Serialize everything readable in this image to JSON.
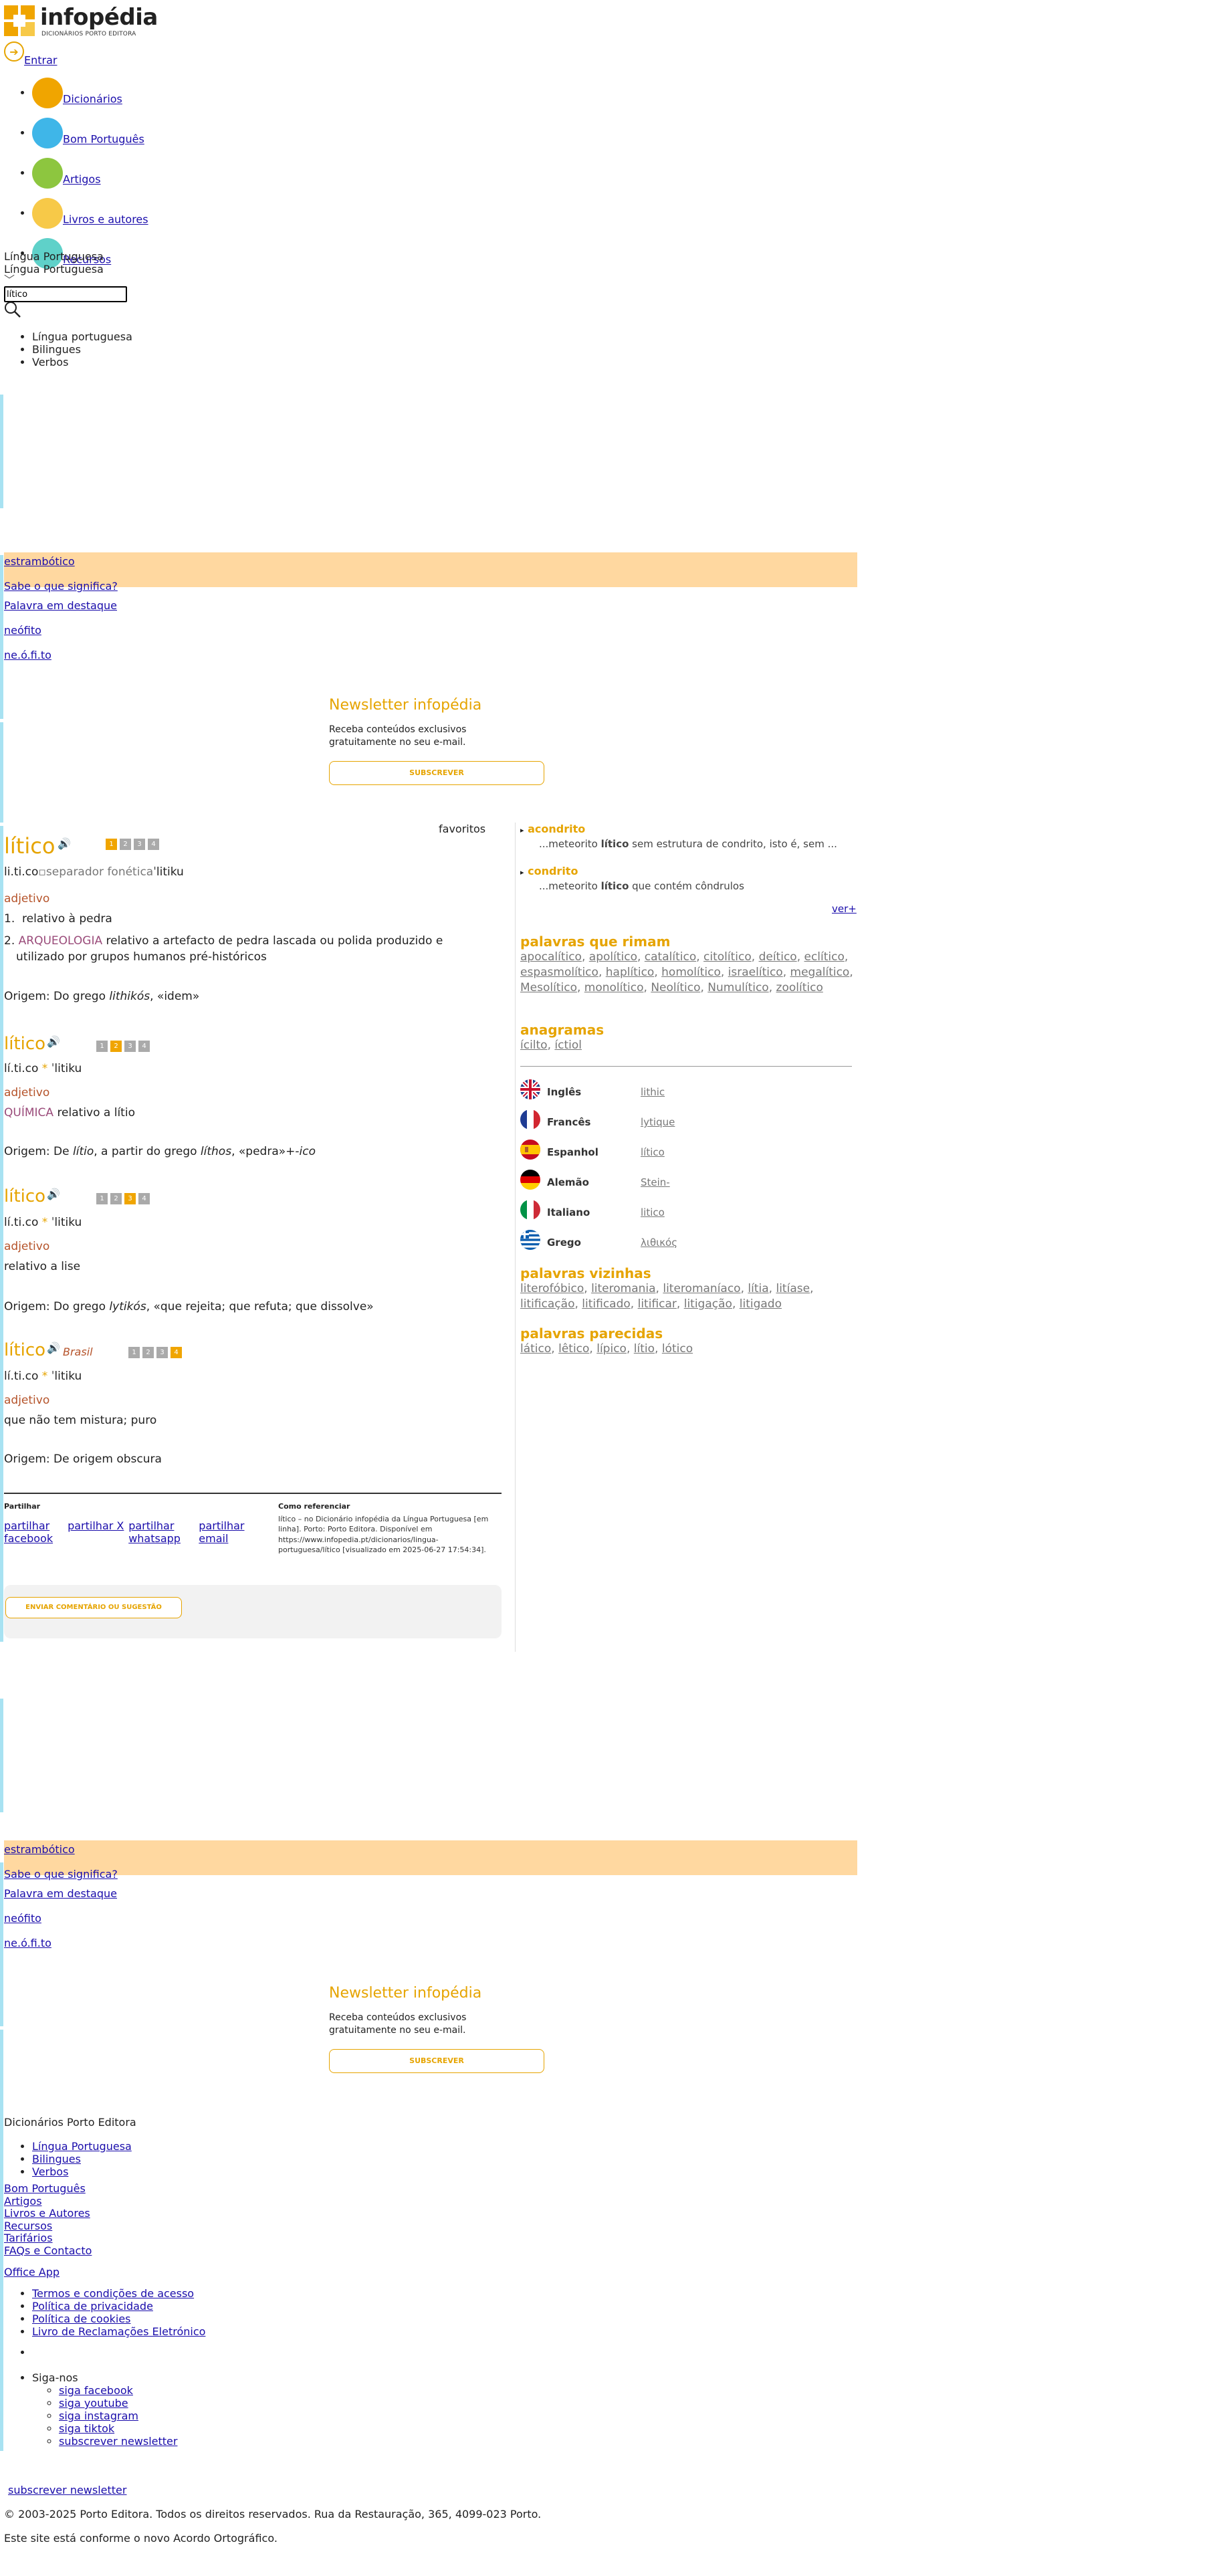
{
  "header": {
    "logo_name": "infopédia",
    "logo_sub": "DICIONÁRIOS PORTO EDITORA",
    "enter_label": "Entrar",
    "nav": [
      {
        "label": "Dicionários",
        "icon": "books-icon",
        "color": "#f0a500"
      },
      {
        "label": "Bom Português",
        "icon": "pen-icon",
        "color": "#3fb6e8"
      },
      {
        "label": "Artigos",
        "icon": "article-icon",
        "color": "#8dc63f"
      },
      {
        "label": "Livros e autores",
        "icon": "author-icon",
        "color": "#f7c948"
      },
      {
        "label": "Recursos",
        "icon": "resources-icon",
        "color": "#5fd1c9"
      }
    ],
    "lang_selected": "Língua Portuguesa",
    "lang_selected_2": "Língua Portuguesa",
    "search_value": "lítico",
    "search_options": [
      "Língua portuguesa",
      "Bilingues",
      "Verbos"
    ]
  },
  "word_of_day": {
    "word": "estrambótico",
    "question": "Sabe o que significa?",
    "featured_label": "Palavra em destaque",
    "featured_word": "neófito",
    "featured_syllables": "ne.ó.fi.to"
  },
  "newsletter": {
    "title": "Newsletter infopédia",
    "text": "Receba conteúdos exclusivos gratuitamente no seu e-mail.",
    "button": "SUBSCREVER"
  },
  "favorites_alt": "favoritos",
  "entries": [
    {
      "headword": "lítico",
      "pages": [
        "1",
        "2",
        "3",
        "4"
      ],
      "active": 0,
      "pron": "li.ti.co",
      "pron_alt": "separador fonética",
      "ipa": "ˈlitiku",
      "pos": "adjetivo",
      "defs": [
        {
          "n": "1.",
          "domain": "",
          "text": "relativo à pedra"
        },
        {
          "n": "2.",
          "domain": "ARQUEOLOGIA",
          "text": "relativo a artefacto de pedra lascada ou polida produzido e utilizado por grupos humanos pré-históricos"
        }
      ],
      "etym_prefix": "Origem: Do grego ",
      "etym_em": "lithikós",
      "etym_suffix": ", «idem»"
    },
    {
      "headword": "lítico",
      "pages": [
        "1",
        "2",
        "3",
        "4"
      ],
      "active": 1,
      "pron": "lí.ti.co",
      "ipa": "ˈlitiku",
      "pos": "adjetivo",
      "domain": "QUÍMICA",
      "def": "relativo a lítio",
      "etym_prefix": "Origem: De ",
      "etym_em": "lítio",
      "etym_mid": ", a partir do grego ",
      "etym_em2": "líthos",
      "etym_suffix": ", «pedra»+-",
      "etym_em3": "ico"
    },
    {
      "headword": "lítico",
      "pages": [
        "1",
        "2",
        "3",
        "4"
      ],
      "active": 2,
      "pron": "lí.ti.co",
      "ipa": "ˈlitiku",
      "pos": "adjetivo",
      "def": "relativo a lise",
      "etym_prefix": "Origem: Do grego ",
      "etym_em": "lytikós",
      "etym_suffix": ", «que rejeita; que refuta; que dissolve»"
    },
    {
      "headword": "lítico",
      "region": "Brasil",
      "pages": [
        "1",
        "2",
        "3",
        "4"
      ],
      "active": 3,
      "pron": "lí.ti.co",
      "ipa": "ˈlitiku",
      "pos": "adjetivo",
      "def": "que não tem mistura; puro",
      "etym": "Origem: De origem obscura"
    }
  ],
  "share": {
    "title": "Partilhar",
    "links": [
      "partilhar facebook",
      "partilhar X",
      "partilhar whatsapp",
      "partilhar email"
    ],
    "cite_title": "Como referenciar",
    "cite_text": "lítico – no Dicionário infopédia da Língua Portuguesa [em linha]. Porto: Porto Editora. Disponível em https://www.infopedia.pt/dicionarios/lingua-portuguesa/lítico [visualizado em 2025-06-27 17:54:34].",
    "feedback_btn": "ENVIAR COMENTÁRIO OU SUGESTÃO"
  },
  "examples": [
    {
      "title": "acondrito",
      "pre": "...meteorito ",
      "bold": "lítico",
      "post": " sem estrutura de condrito, isto é, sem ..."
    },
    {
      "title": "condrito",
      "pre": "...meteorito ",
      "bold": "lítico",
      "post": " que contém côndrulos"
    }
  ],
  "see_more": "ver+",
  "rhymes": {
    "title": "palavras que rimam",
    "words": [
      "apocalítico",
      "apolítico",
      "catalítico",
      "citolítico",
      "deítico",
      "eclítico",
      "espasmolítico",
      "haplítico",
      "homolítico",
      "israelítico",
      "megalítico",
      "Mesolítico",
      "monolítico",
      "Neolítico",
      "Numulítico",
      "zoolítico"
    ]
  },
  "anagrams": {
    "title": "anagramas",
    "words": [
      "ícilto",
      "íctiol"
    ]
  },
  "translations": [
    {
      "lang": "Inglês",
      "word": "lithic",
      "flag": "uk-flag"
    },
    {
      "lang": "Francês",
      "word": "lytique",
      "flag": "fr-flag"
    },
    {
      "lang": "Espanhol",
      "word": "lítico",
      "flag": "es-flag"
    },
    {
      "lang": "Alemão",
      "word": "Stein-",
      "flag": "de-flag"
    },
    {
      "lang": "Italiano",
      "word": "litico",
      "flag": "it-flag"
    },
    {
      "lang": "Grego",
      "word": "λιθικός",
      "flag": "gr-flag"
    }
  ],
  "neighbors": {
    "title": "palavras vizinhas",
    "words": [
      "literofóbico",
      "literomania",
      "literomaníaco",
      "lítia",
      "litíase",
      "litificação",
      "litificado",
      "litificar",
      "litigação",
      "litigado"
    ]
  },
  "similar": {
    "title": "palavras parecidas",
    "words": [
      "lático",
      "lêtico",
      "lípico",
      "lítio",
      "lótico"
    ]
  },
  "footer": {
    "heading": "Dicionários Porto Editora",
    "dict_links": [
      "Língua Portuguesa",
      "Bilingues",
      "Verbos"
    ],
    "links": [
      "Bom Português",
      "Artigos",
      "Livros e Autores",
      "Recursos",
      "Tarifários",
      "FAQs e Contacto"
    ],
    "office": "Office App",
    "legal": [
      "Termos e condições de acesso",
      "Política de privacidade",
      "Política de cookies",
      "Livro de Reclamações Eletrónico"
    ],
    "follow": "Siga-nos",
    "social": [
      "siga facebook",
      "siga youtube",
      "siga instagram",
      "siga tiktok",
      "subscrever newsletter"
    ],
    "subscribe": "subscrever newsletter",
    "copyright": "© 2003-2025 Porto Editora. Todos os direitos reservados. Rua da Restauração, 365, 4099-023 Porto.",
    "agreement": "Este site está conforme o novo Acordo Ortográfico."
  }
}
